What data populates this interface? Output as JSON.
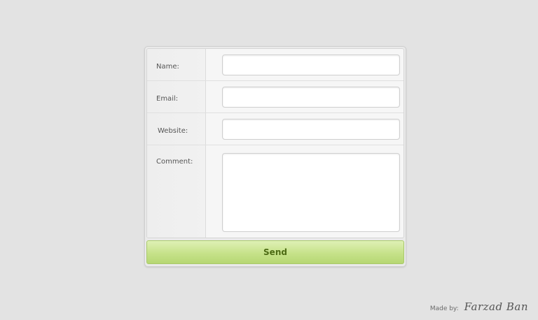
{
  "form": {
    "fields": [
      {
        "label": "Name:",
        "value": ""
      },
      {
        "label": "Email:",
        "value": ""
      },
      {
        "label": "Website:",
        "value": ""
      },
      {
        "label": "Comment:",
        "value": ""
      }
    ],
    "submit_label": "Send"
  },
  "footer": {
    "made_by_label": "Made by:",
    "author_signature": "Farzad Ban"
  },
  "colors": {
    "background": "#e3e3e3",
    "button_green": "#c6e28a",
    "button_text": "#4d6b14"
  }
}
